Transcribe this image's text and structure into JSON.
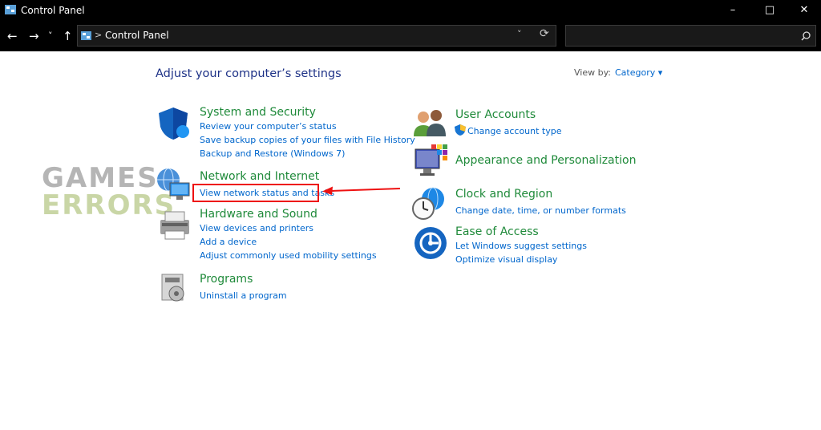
{
  "window": {
    "title": "Control Panel",
    "minimize": "–",
    "maximize": "□",
    "close": "✕"
  },
  "nav": {
    "back": "←",
    "forward": "→",
    "recent": "˅",
    "up": "↑"
  },
  "address": {
    "path": "Control Panel",
    "chevron": ">",
    "dropdown": "˅",
    "refresh": "⟳"
  },
  "search": {
    "placeholder": "",
    "icon": "search-icon"
  },
  "main": {
    "heading": "Adjust your computer’s settings",
    "view_by_label": "View by:",
    "view_by_value": "Category ▾"
  },
  "categories": {
    "system_security": {
      "title": "System and Security",
      "links": [
        "Review your computer’s status",
        "Save backup copies of your files with File History",
        "Backup and Restore (Windows 7)"
      ]
    },
    "network_internet": {
      "title": "Network and Internet",
      "links": [
        "View network status and tasks"
      ]
    },
    "hardware_sound": {
      "title": "Hardware and Sound",
      "links": [
        "View devices and printers",
        "Add a device",
        "Adjust commonly used mobility settings"
      ]
    },
    "programs": {
      "title": "Programs",
      "links": [
        "Uninstall a program"
      ]
    },
    "user_accounts": {
      "title": "User Accounts",
      "links": [
        "Change account type"
      ]
    },
    "appearance": {
      "title": "Appearance and Personalization",
      "links": []
    },
    "clock_region": {
      "title": "Clock and Region",
      "links": [
        "Change date, time, or number formats"
      ]
    },
    "ease_access": {
      "title": "Ease of Access",
      "links": [
        "Let Windows suggest settings",
        "Optimize visual display"
      ]
    }
  },
  "watermark": {
    "line1": "GAMES",
    "line2": "ERRORS"
  },
  "colors": {
    "title_green": "#1f8a3a",
    "link_blue": "#0066cc",
    "heading_blue": "#1e3287",
    "highlight_red": "#ee1111"
  }
}
